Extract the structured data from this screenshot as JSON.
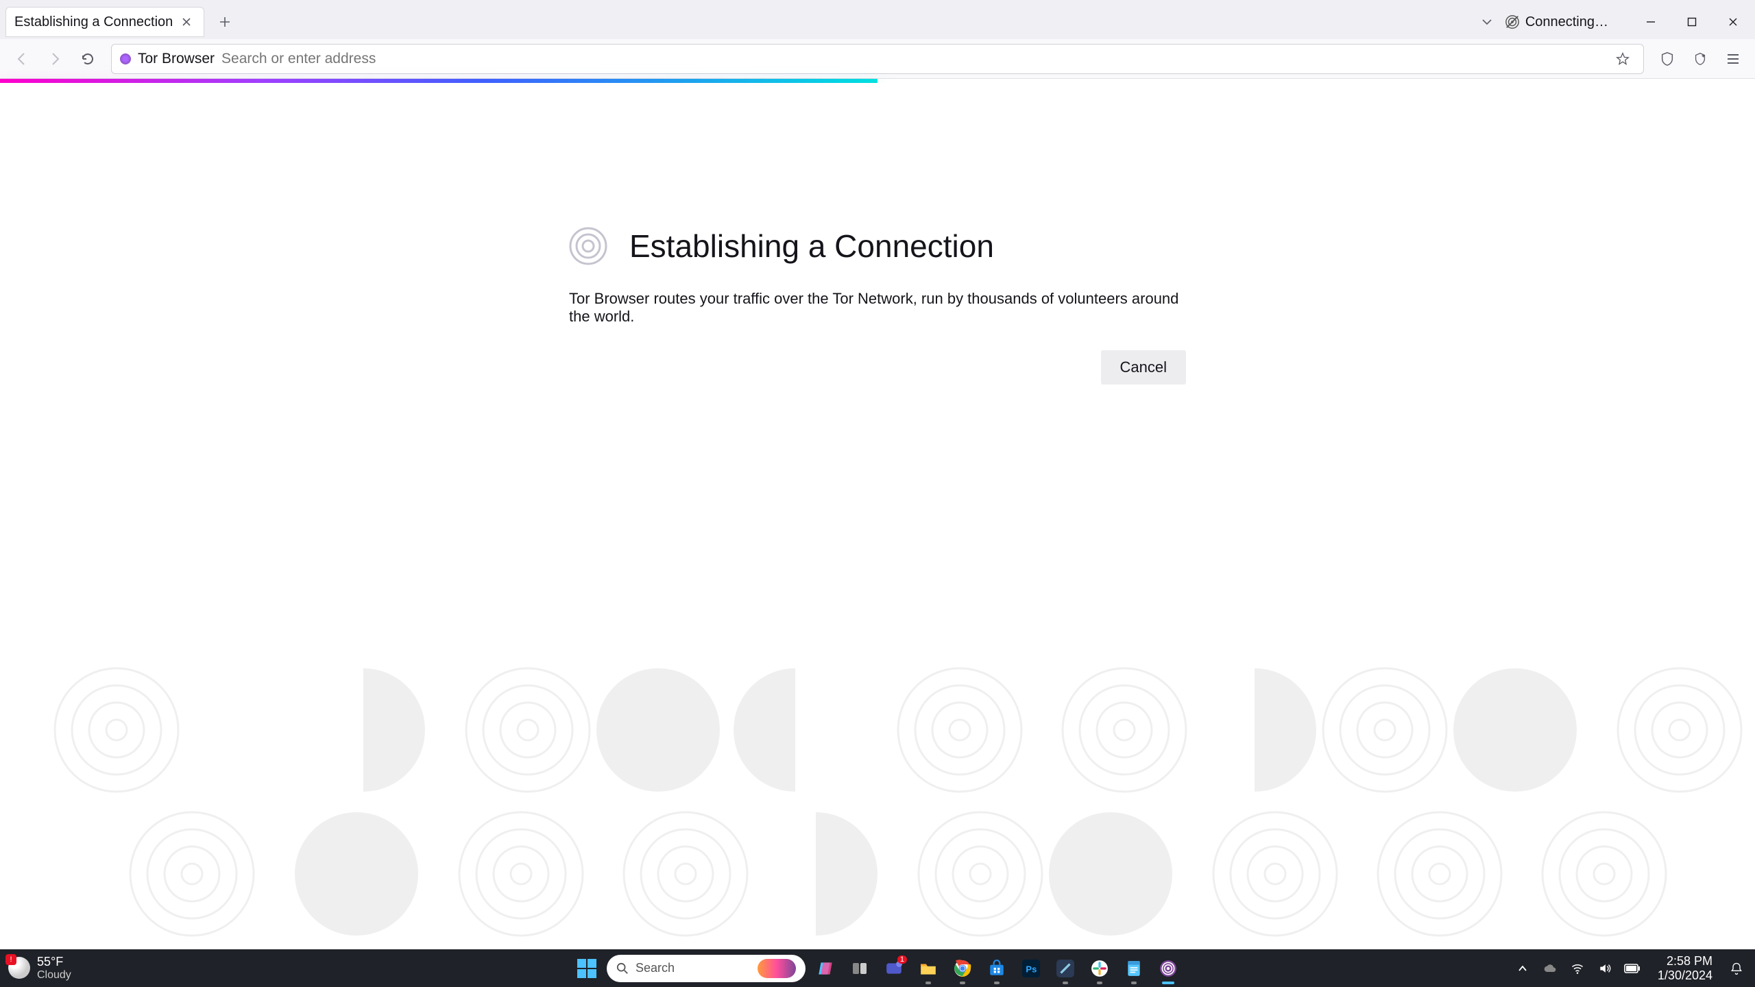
{
  "window": {
    "tab_title": "Establishing a Connection",
    "connecting_label": "Connecting…"
  },
  "toolbar": {
    "identity_label": "Tor Browser",
    "url_placeholder": "Search or enter address"
  },
  "page": {
    "title": "Establishing a Connection",
    "description": "Tor Browser routes your traffic over the Tor Network, run by thousands of volunteers around the world.",
    "cancel_label": "Cancel"
  },
  "taskbar": {
    "weather_temp": "55°F",
    "weather_desc": "Cloudy",
    "search_placeholder": "Search",
    "clock_time": "2:58 PM",
    "clock_date": "1/30/2024"
  },
  "progress_percent": 50
}
